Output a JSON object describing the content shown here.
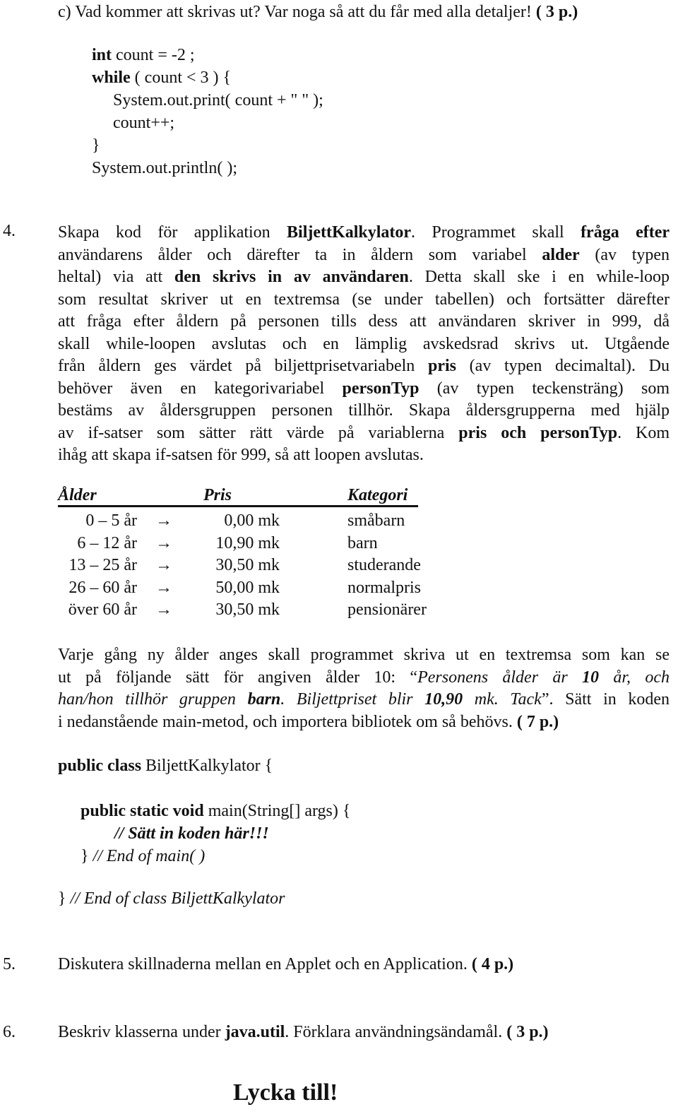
{
  "question_c": {
    "text": "c) Vad kommer att skrivas ut? Var noga så att du får med alla detaljer! ",
    "points": "( 3 p.)"
  },
  "code_c": [
    {
      "kw": "int",
      "rest": " count = -2 ;"
    },
    {
      "kw": "while",
      "rest": " ( count < 3 )  {"
    },
    {
      "kw": "",
      "rest": "System.out.print( count + \" \" );"
    },
    {
      "kw": "",
      "rest": "count++;"
    },
    {
      "kw": "",
      "rest": "}"
    },
    {
      "kw": "",
      "rest": "System.out.println( );"
    }
  ],
  "q4": {
    "number": "4.",
    "lines": [
      [
        "Skapa kod för applikation ",
        {
          "b": "BiljettKalkylator"
        },
        ". Programmet skall ",
        {
          "b": "fråga efter"
        }
      ],
      [
        "användarens ålder och därefter ta in åldern som variabel ",
        {
          "b": "alder"
        },
        " (av typen"
      ],
      [
        "heltal) via att ",
        {
          "b": "den skrivs in av användaren"
        },
        ". Detta skall ske i en while-loop"
      ],
      [
        "som resultat skriver ut en textremsa (se under tabellen) och fortsätter därefter"
      ],
      [
        "att fråga efter åldern på personen tills dess att användaren skriver in 999, då"
      ],
      [
        "skall while-loopen avslutas och en lämplig avskedsrad skrivs ut. Utgående"
      ],
      [
        "från åldern ges värdet på biljettprisetvariabeln ",
        {
          "b": "pris"
        },
        " (av typen decimaltal). Du"
      ],
      [
        "behöver även en kategorivariabel ",
        {
          "b": "personTyp"
        },
        " (av typen teckensträng) som"
      ],
      [
        "bestäms av åldersgruppen personen tillhör. Skapa åldersgrupperna med hjälp"
      ],
      [
        "av if-satser som sätter rätt värde på variablerna ",
        {
          "b": "pris och personTyp"
        },
        ". Kom"
      ],
      [
        "ihåg att skapa if-satsen för 999, så att loopen avslutas."
      ]
    ]
  },
  "table": {
    "headers": [
      "Ålder",
      "Pris",
      "Kategori"
    ],
    "arrow": "→",
    "rows": [
      {
        "age": "0 –   5 år",
        "price": "0,00 mk",
        "category": "småbarn"
      },
      {
        "age": "6 – 12 år",
        "price": "10,90 mk",
        "category": "barn"
      },
      {
        "age": "13 – 25 år",
        "price": "30,50 mk",
        "category": "studerande"
      },
      {
        "age": "26 – 60 år",
        "price": "50,00 mk",
        "category": "normalpris"
      },
      {
        "age": "över 60 år",
        "price": "30,50 mk",
        "category": "pensionärer"
      }
    ]
  },
  "q4b": {
    "lines": [
      [
        "Varje gång ny ålder anges skall programmet skriva ut en textremsa som kan se"
      ],
      [
        "ut på följande sätt för angiven ålder 10: “",
        {
          "i": "Personens ålder är "
        },
        {
          "bi": "10"
        },
        {
          "i": " år, och"
        }
      ],
      [
        {
          "i": "han/hon tillhör gruppen "
        },
        {
          "bi": "barn"
        },
        {
          "i": ". Biljettpriset blir "
        },
        {
          "bi": "10,90"
        },
        {
          "i": " mk. Tack"
        },
        "”. Sätt in koden"
      ],
      [
        "i nedanstående main-metod, och importera bibliotek om så behövs. ",
        {
          "b": "( 7 p.)"
        }
      ]
    ]
  },
  "code_main": {
    "class_kw": "public class",
    "class_name": " BiljettKalkylator {",
    "main_kw": "public static void",
    "main_rest": " main(String[] args) {",
    "comment_insert": "//  Sätt in koden här!!!",
    "end_main_brace": "}",
    "end_main_comment": " // End of main( )",
    "end_class_brace": "}",
    "end_class_comment": " // End of class BiljettKalkylator"
  },
  "q5": {
    "number": "5.",
    "text": "Diskutera skillnaderna mellan en Applet och en Application. ",
    "points": "( 4 p.)"
  },
  "q6": {
    "number": "6.",
    "text_before": "Beskriv klasserna under ",
    "bold": "java.util",
    "text_after": ". Förklara användningsändamål. ",
    "points": "( 3 p.)"
  },
  "closing": "Lycka till!"
}
